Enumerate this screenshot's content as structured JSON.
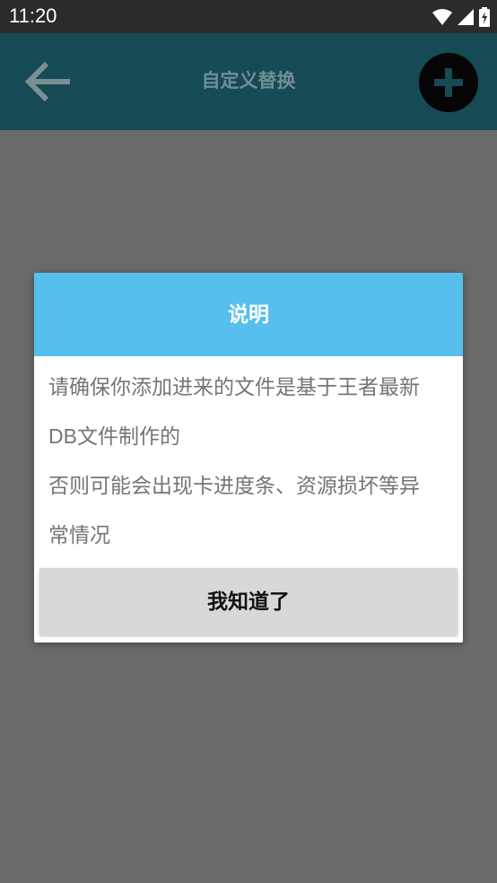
{
  "status_bar": {
    "time": "11:20",
    "icons": [
      "wifi-icon",
      "cell-signal-icon",
      "battery-charging-icon"
    ]
  },
  "toolbar": {
    "title": "自定义替换",
    "back_icon": "arrow-left-icon",
    "add_icon": "plus-icon",
    "background": "#164a55"
  },
  "dialog": {
    "title": "说明",
    "lines": [
      "请确保你添加进来的文件是基于王者最新",
      "DB文件制作的",
      "否则可能会出现卡进度条、资源损坏等异",
      "常情况"
    ],
    "confirm_label": "我知道了",
    "header_color": "#57bfee"
  }
}
